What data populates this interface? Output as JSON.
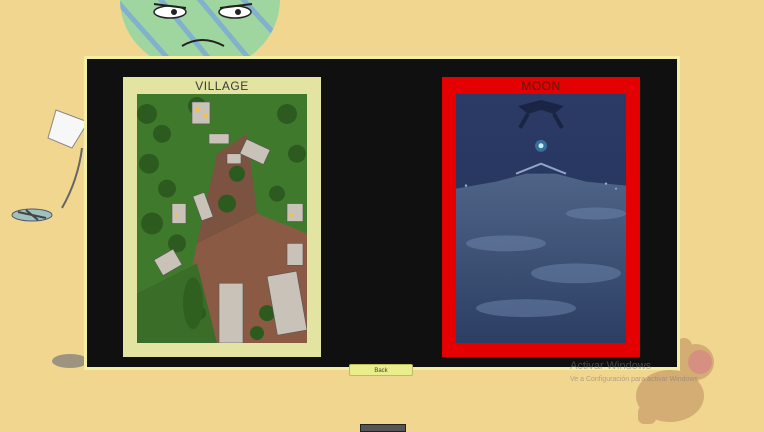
{
  "levels": {
    "village": {
      "label": "VILLAGE"
    },
    "moon": {
      "label": "MOON"
    }
  },
  "controls": {
    "back_label": "Back"
  },
  "watermark": {
    "title": "Activar Windows",
    "subtitle": "Ve a Configuración para activar Windows."
  },
  "colors": {
    "background": "#f1d68f",
    "panel": "#101010",
    "village_frame": "#e3e4a2",
    "moon_frame_selected": "#e40000",
    "back_button": "#e9ed8b"
  },
  "icons": [
    "planet-face-decoration",
    "lamp-decoration",
    "bear-silhouette-decoration",
    "ufo-icon",
    "glow-star-icon"
  ]
}
